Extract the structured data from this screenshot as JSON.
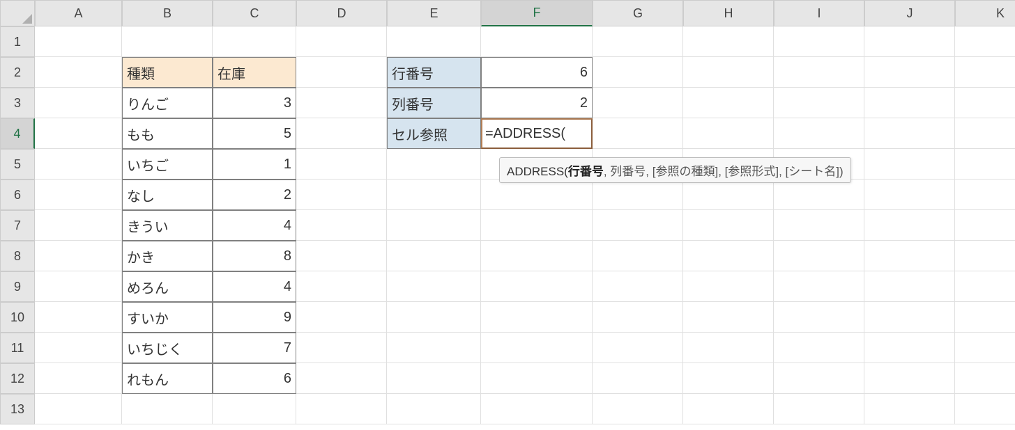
{
  "columns": [
    "A",
    "B",
    "C",
    "D",
    "E",
    "F",
    "G",
    "H",
    "I",
    "J",
    "K"
  ],
  "rows": [
    "1",
    "2",
    "3",
    "4",
    "5",
    "6",
    "7",
    "8",
    "9",
    "10",
    "11",
    "12",
    "13"
  ],
  "selected_col_index": 5,
  "selected_row_index": 3,
  "table1": {
    "headers": [
      "種類",
      "在庫"
    ],
    "rows": [
      {
        "name": "りんご",
        "stock": "3"
      },
      {
        "name": "もも",
        "stock": "5"
      },
      {
        "name": "いちご",
        "stock": "1"
      },
      {
        "name": "なし",
        "stock": "2"
      },
      {
        "name": "きうい",
        "stock": "4"
      },
      {
        "name": "かき",
        "stock": "8"
      },
      {
        "name": "めろん",
        "stock": "4"
      },
      {
        "name": "すいか",
        "stock": "9"
      },
      {
        "name": "いちじく",
        "stock": "7"
      },
      {
        "name": "れもん",
        "stock": "6"
      }
    ]
  },
  "table2": {
    "row_label": "行番号",
    "row_value": "6",
    "col_label": "列番号",
    "col_value": "2",
    "ref_label": "セル参照",
    "ref_formula": "=ADDRESS("
  },
  "tooltip": {
    "fn": "ADDRESS(",
    "arg_bold": "行番号",
    "rest": ", 列番号, [参照の種類], [参照形式], [シート名])"
  }
}
